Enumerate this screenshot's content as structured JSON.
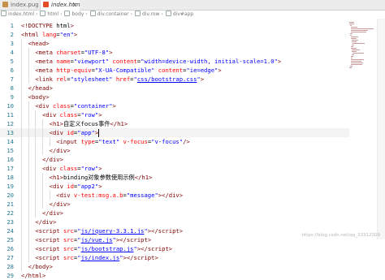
{
  "tabs": [
    {
      "label": "index.pug",
      "icon": "pug-file-icon",
      "color": "#c8914a"
    },
    {
      "label": "index.html",
      "icon": "html-file-icon",
      "color": "#e44d26"
    }
  ],
  "breadcrumb": [
    "index.html",
    "html",
    "body",
    "div.container",
    "div.row",
    "div#app"
  ],
  "editor": {
    "active_line": 13,
    "lines": [
      {
        "n": "1",
        "tokens": [
          [
            "pun",
            "<!"
          ],
          [
            "tag",
            "DOCTYPE"
          ],
          [
            "txt",
            " html"
          ],
          [
            "pun",
            ">"
          ]
        ]
      },
      {
        "n": "2",
        "tokens": [
          [
            "pun",
            "<"
          ],
          [
            "tag",
            "html"
          ],
          [
            "txt",
            " "
          ],
          [
            "attr",
            "lang"
          ],
          [
            "txt",
            "="
          ],
          [
            "str",
            "\"en\""
          ],
          [
            "pun",
            ">"
          ]
        ]
      },
      {
        "n": "3",
        "tokens": [
          [
            "txt",
            "  "
          ],
          [
            "pun",
            "<"
          ],
          [
            "tag",
            "head"
          ],
          [
            "pun",
            ">"
          ]
        ]
      },
      {
        "n": "4",
        "tokens": [
          [
            "txt",
            "    "
          ],
          [
            "pun",
            "<"
          ],
          [
            "tag",
            "meta"
          ],
          [
            "txt",
            " "
          ],
          [
            "attr",
            "charset"
          ],
          [
            "txt",
            "="
          ],
          [
            "str",
            "\"UTF-8\""
          ],
          [
            "pun",
            ">"
          ]
        ]
      },
      {
        "n": "5",
        "tokens": [
          [
            "txt",
            "    "
          ],
          [
            "pun",
            "<"
          ],
          [
            "tag",
            "meta"
          ],
          [
            "txt",
            " "
          ],
          [
            "attr",
            "name"
          ],
          [
            "txt",
            "="
          ],
          [
            "str",
            "\"viewport\""
          ],
          [
            "txt",
            " "
          ],
          [
            "attr",
            "content"
          ],
          [
            "txt",
            "="
          ],
          [
            "str",
            "\"width=device-width, initial-scale=1.0\""
          ],
          [
            "pun",
            ">"
          ]
        ]
      },
      {
        "n": "6",
        "tokens": [
          [
            "txt",
            "    "
          ],
          [
            "pun",
            "<"
          ],
          [
            "tag",
            "meta"
          ],
          [
            "txt",
            " "
          ],
          [
            "attr",
            "http-equiv"
          ],
          [
            "txt",
            "="
          ],
          [
            "str",
            "\"X-UA-Compatible\""
          ],
          [
            "txt",
            " "
          ],
          [
            "attr",
            "content"
          ],
          [
            "txt",
            "="
          ],
          [
            "str",
            "\"ie=edge\""
          ],
          [
            "pun",
            ">"
          ]
        ]
      },
      {
        "n": "7",
        "tokens": [
          [
            "txt",
            "    "
          ],
          [
            "pun",
            "<"
          ],
          [
            "tag",
            "link"
          ],
          [
            "txt",
            " "
          ],
          [
            "attr",
            "rel"
          ],
          [
            "txt",
            "="
          ],
          [
            "str",
            "\"stylesheet\""
          ],
          [
            "txt",
            " "
          ],
          [
            "attr",
            "href"
          ],
          [
            "txt",
            "="
          ],
          [
            "str",
            "\""
          ],
          [
            "stru",
            "css/bootstrap.css"
          ],
          [
            "str",
            "\""
          ],
          [
            "pun",
            ">"
          ]
        ]
      },
      {
        "n": "8",
        "tokens": [
          [
            "txt",
            "  "
          ],
          [
            "pun",
            "</"
          ],
          [
            "tag",
            "head"
          ],
          [
            "pun",
            ">"
          ]
        ]
      },
      {
        "n": "9",
        "tokens": [
          [
            "txt",
            "  "
          ],
          [
            "pun",
            "<"
          ],
          [
            "tag",
            "body"
          ],
          [
            "pun",
            ">"
          ]
        ]
      },
      {
        "n": "10",
        "tokens": [
          [
            "txt",
            "    "
          ],
          [
            "pun",
            "<"
          ],
          [
            "tag",
            "div"
          ],
          [
            "txt",
            " "
          ],
          [
            "attr",
            "class"
          ],
          [
            "txt",
            "="
          ],
          [
            "str",
            "\"container\""
          ],
          [
            "pun",
            ">"
          ]
        ]
      },
      {
        "n": "11",
        "tokens": [
          [
            "txt",
            "      "
          ],
          [
            "pun",
            "<"
          ],
          [
            "tag",
            "div"
          ],
          [
            "txt",
            " "
          ],
          [
            "attr",
            "class"
          ],
          [
            "txt",
            "="
          ],
          [
            "str",
            "\"row\""
          ],
          [
            "pun",
            ">"
          ]
        ]
      },
      {
        "n": "12",
        "tokens": [
          [
            "txt",
            "        "
          ],
          [
            "pun",
            "<"
          ],
          [
            "tag",
            "h1"
          ],
          [
            "pun",
            ">"
          ],
          [
            "txt",
            "自定义focus事件"
          ],
          [
            "pun",
            "</"
          ],
          [
            "tag",
            "h1"
          ],
          [
            "pun",
            ">"
          ]
        ]
      },
      {
        "n": "13",
        "tokens": [
          [
            "txt",
            "        "
          ],
          [
            "pun",
            "<"
          ],
          [
            "tag",
            "div"
          ],
          [
            "txt",
            " "
          ],
          [
            "attr",
            "id"
          ],
          [
            "txt",
            "="
          ],
          [
            "str",
            "\"app\""
          ],
          [
            "pun",
            ">"
          ]
        ]
      },
      {
        "n": "14",
        "tokens": [
          [
            "txt",
            "          "
          ],
          [
            "pun",
            "<"
          ],
          [
            "tag",
            "input"
          ],
          [
            "txt",
            " "
          ],
          [
            "attr",
            "type"
          ],
          [
            "txt",
            "="
          ],
          [
            "str",
            "\"text\""
          ],
          [
            "txt",
            " "
          ],
          [
            "attr",
            "v-focus"
          ],
          [
            "txt",
            "="
          ],
          [
            "str",
            "\"v-focus\""
          ],
          [
            "pun",
            "/>"
          ]
        ]
      },
      {
        "n": "15",
        "tokens": [
          [
            "txt",
            "        "
          ],
          [
            "pun",
            "</"
          ],
          [
            "tag",
            "div"
          ],
          [
            "pun",
            ">"
          ]
        ]
      },
      {
        "n": "16",
        "tokens": [
          [
            "txt",
            "      "
          ],
          [
            "pun",
            "</"
          ],
          [
            "tag",
            "div"
          ],
          [
            "pun",
            ">"
          ]
        ]
      },
      {
        "n": "17",
        "tokens": [
          [
            "txt",
            "      "
          ],
          [
            "pun",
            "<"
          ],
          [
            "tag",
            "div"
          ],
          [
            "txt",
            " "
          ],
          [
            "attr",
            "class"
          ],
          [
            "txt",
            "="
          ],
          [
            "str",
            "\"row\""
          ],
          [
            "pun",
            ">"
          ]
        ]
      },
      {
        "n": "18",
        "tokens": [
          [
            "txt",
            "        "
          ],
          [
            "pun",
            "<"
          ],
          [
            "tag",
            "h1"
          ],
          [
            "pun",
            ">"
          ],
          [
            "txt",
            "binding对象参数使用示例"
          ],
          [
            "pun",
            "</"
          ],
          [
            "tag",
            "h1"
          ],
          [
            "pun",
            ">"
          ]
        ]
      },
      {
        "n": "19",
        "tokens": [
          [
            "txt",
            "        "
          ],
          [
            "pun",
            "<"
          ],
          [
            "tag",
            "div"
          ],
          [
            "txt",
            " "
          ],
          [
            "attr",
            "id"
          ],
          [
            "txt",
            "="
          ],
          [
            "str",
            "\"app2\""
          ],
          [
            "pun",
            ">"
          ]
        ]
      },
      {
        "n": "20",
        "tokens": [
          [
            "txt",
            "          "
          ],
          [
            "pun",
            "<"
          ],
          [
            "tag",
            "div"
          ],
          [
            "txt",
            " "
          ],
          [
            "attr",
            "v-test:msg.a.b"
          ],
          [
            "txt",
            "="
          ],
          [
            "str",
            "\"message\""
          ],
          [
            "pun",
            "></"
          ],
          [
            "tag",
            "div"
          ],
          [
            "pun",
            ">"
          ]
        ]
      },
      {
        "n": "21",
        "tokens": [
          [
            "txt",
            "        "
          ],
          [
            "pun",
            "</"
          ],
          [
            "tag",
            "div"
          ],
          [
            "pun",
            ">"
          ]
        ]
      },
      {
        "n": "22",
        "tokens": [
          [
            "txt",
            "      "
          ],
          [
            "pun",
            "</"
          ],
          [
            "tag",
            "div"
          ],
          [
            "pun",
            ">"
          ]
        ]
      },
      {
        "n": "23",
        "tokens": [
          [
            "txt",
            "    "
          ],
          [
            "pun",
            "</"
          ],
          [
            "tag",
            "div"
          ],
          [
            "pun",
            ">"
          ]
        ]
      },
      {
        "n": "24",
        "tokens": [
          [
            "txt",
            "    "
          ],
          [
            "pun",
            "<"
          ],
          [
            "tag",
            "script"
          ],
          [
            "txt",
            " "
          ],
          [
            "attr",
            "src"
          ],
          [
            "txt",
            "="
          ],
          [
            "str",
            "\""
          ],
          [
            "stru",
            "js/jquery-3.3.1.js"
          ],
          [
            "str",
            "\""
          ],
          [
            "pun",
            "></"
          ],
          [
            "tag",
            "script"
          ],
          [
            "pun",
            ">"
          ]
        ]
      },
      {
        "n": "25",
        "tokens": [
          [
            "txt",
            "    "
          ],
          [
            "pun",
            "<"
          ],
          [
            "tag",
            "script"
          ],
          [
            "txt",
            " "
          ],
          [
            "attr",
            "src"
          ],
          [
            "txt",
            "="
          ],
          [
            "str",
            "\""
          ],
          [
            "stru",
            "js/vue.js"
          ],
          [
            "str",
            "\""
          ],
          [
            "pun",
            "></"
          ],
          [
            "tag",
            "script"
          ],
          [
            "pun",
            ">"
          ]
        ]
      },
      {
        "n": "26",
        "tokens": [
          [
            "txt",
            "    "
          ],
          [
            "pun",
            "<"
          ],
          [
            "tag",
            "script"
          ],
          [
            "txt",
            " "
          ],
          [
            "attr",
            "src"
          ],
          [
            "txt",
            "="
          ],
          [
            "str",
            "\""
          ],
          [
            "stru",
            "js/bootstrap.js"
          ],
          [
            "str",
            "\""
          ],
          [
            "pun",
            "></"
          ],
          [
            "tag",
            "script"
          ],
          [
            "pun",
            ">"
          ]
        ]
      },
      {
        "n": "27",
        "tokens": [
          [
            "txt",
            "    "
          ],
          [
            "pun",
            "<"
          ],
          [
            "tag",
            "script"
          ],
          [
            "txt",
            " "
          ],
          [
            "attr",
            "src"
          ],
          [
            "txt",
            "="
          ],
          [
            "str",
            "\""
          ],
          [
            "stru",
            "js/index.js"
          ],
          [
            "str",
            "\""
          ],
          [
            "pun",
            "></"
          ],
          [
            "tag",
            "script"
          ],
          [
            "pun",
            ">"
          ]
        ]
      },
      {
        "n": "28",
        "tokens": [
          [
            "txt",
            "  "
          ],
          [
            "pun",
            "</"
          ],
          [
            "tag",
            "body"
          ],
          [
            "pun",
            ">"
          ]
        ]
      },
      {
        "n": "29",
        "tokens": [
          [
            "pun",
            "</"
          ],
          [
            "tag",
            "html"
          ],
          [
            "pun",
            ">"
          ]
        ]
      }
    ]
  },
  "watermark": "https://blog.csdn.net/qq_33312309"
}
